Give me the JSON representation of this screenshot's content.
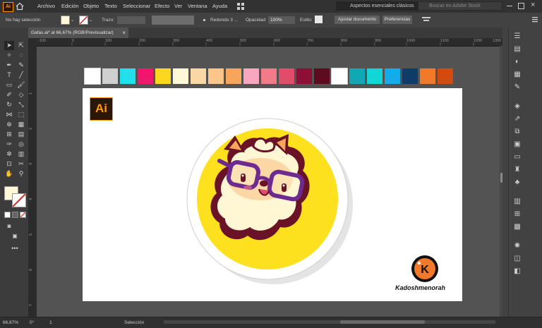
{
  "menubar": {
    "items": [
      "Archivo",
      "Edición",
      "Objeto",
      "Texto",
      "Seleccionar",
      "Efecto",
      "Ver",
      "Ventana",
      "Ayuda"
    ],
    "app_icon": "Ai",
    "workspace": "Aspectos esenciales clásicos",
    "search_placeholder": "Buscar en Adobe Stock"
  },
  "control_bar": {
    "selection": "No hay selección",
    "stroke_label": "Trazo:",
    "brush": "Redondo 3 ...",
    "opacity_label": "Opacidad:",
    "opacity_value": "100%",
    "style_label": "Estilo:",
    "doc_setup": "Ajustar documento",
    "preferences": "Preferencias"
  },
  "document_tab": {
    "title": "Gafas.ai* al 66,67% (RGB/Previsualizar)",
    "close": "×"
  },
  "ruler": {
    "h_ticks": [
      "-100",
      "0",
      "100",
      "200",
      "300",
      "400",
      "500",
      "600",
      "700",
      "800",
      "900",
      "1000",
      "1100",
      "1200",
      "1300",
      "1400"
    ],
    "v_ticks": [
      "1",
      "2",
      "3",
      "4",
      "5",
      "6",
      "7"
    ]
  },
  "swatches": [
    "#ffffff",
    "#cfcfcf",
    "#22e0eb",
    "#f0166b",
    "#fbd61e",
    "#fff8d6",
    "#fcd7a6",
    "#fcc68b",
    "#f6a55b",
    "#f9a6c1",
    "#f27b8a",
    "#e04c6a",
    "#8e0f36",
    "#5e0b1f",
    "#ffffff",
    "#10a8b4",
    "#12d6d6",
    "#14abeb",
    "#0e3b68",
    "#f07a2a",
    "#d24a0e"
  ],
  "artwork": {
    "ai_logo": "Ai",
    "signature": "Kadoshmenorah",
    "logo_letter": "K"
  },
  "statusbar": {
    "zoom": "66,67%",
    "rotation": "0°",
    "artboard": "1",
    "tool": "Selección"
  },
  "colors": {
    "yellow": "#fde01e",
    "dark_outline": "#6a1326",
    "purple": "#6e2a8e",
    "cream": "#fff6d4"
  }
}
